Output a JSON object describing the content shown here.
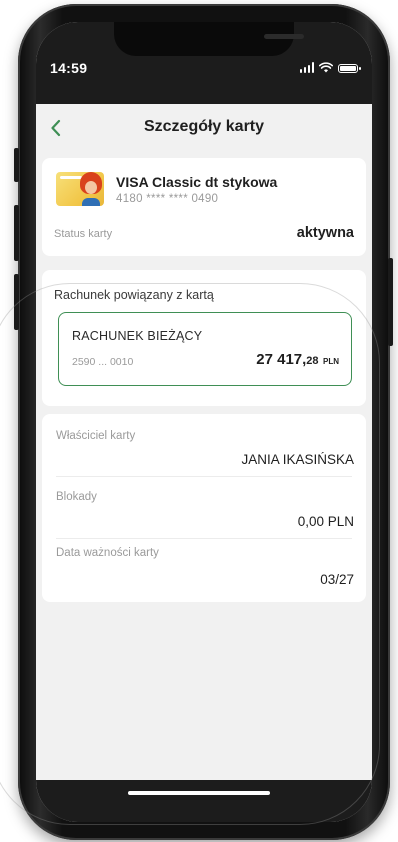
{
  "statusbar": {
    "time": "14:59"
  },
  "header": {
    "title": "Szczegóły karty"
  },
  "card": {
    "name": "VISA Classic dt stykowa",
    "number": "4180 **** **** 0490",
    "status_label": "Status karty",
    "status_value": "aktywna"
  },
  "linked_account": {
    "section_label": "Rachunek powiązany z kartą",
    "account_name": "RACHUNEK BIEŻĄCY",
    "account_number": "2590 ... 0010",
    "balance_main": "27 417,",
    "balance_decimals": "28",
    "currency": "PLN"
  },
  "details": {
    "owner_label": "Właściciel karty",
    "owner_value": "JANIA IKASIŃSKA",
    "blocks_label": "Blokady",
    "blocks_value": "0,00 PLN",
    "expiry_label": "Data ważności karty",
    "expiry_value": "03/27"
  },
  "colors": {
    "accent_green": "#3f8f55",
    "card_bg": "#ffffff",
    "screen_bg": "#f1f1f1"
  }
}
